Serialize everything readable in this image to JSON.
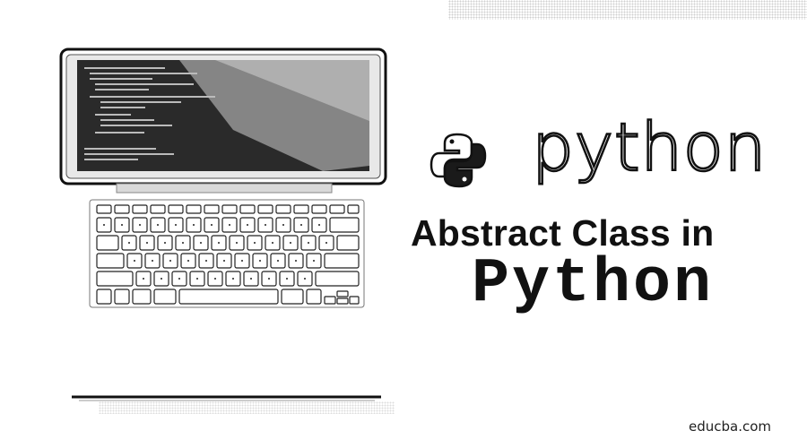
{
  "brand": {
    "wordmark": "python",
    "logo_icon": "python-logo-icon"
  },
  "headline": {
    "line1": "Abstract Class in",
    "line2": "Python"
  },
  "footer": {
    "site": "educba.com"
  },
  "illustration": {
    "icon": "laptop-icon"
  },
  "colors": {
    "ink": "#111111",
    "background": "#ffffff",
    "screen": "#2a2a2a"
  }
}
